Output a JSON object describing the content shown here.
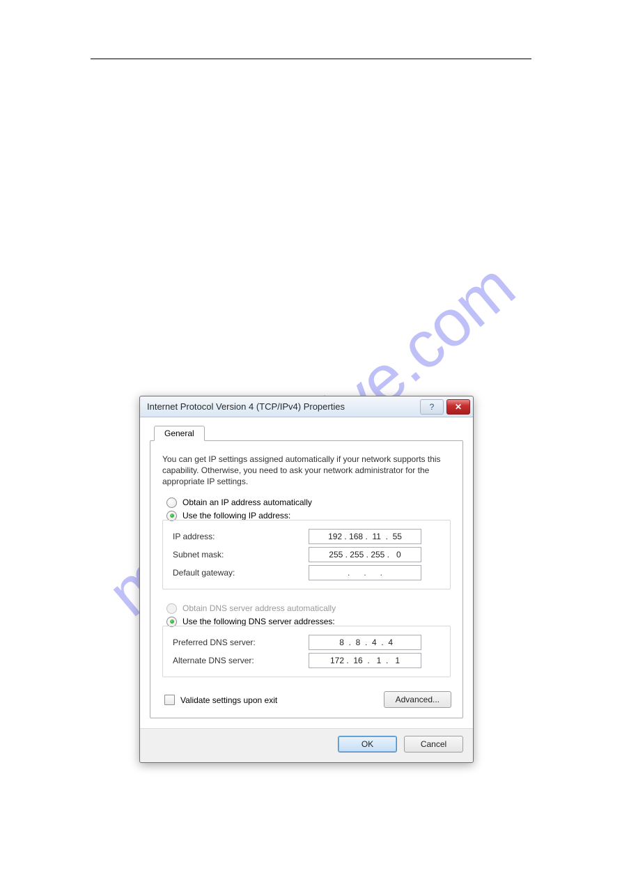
{
  "watermark": "manualshive.com",
  "dialog": {
    "title": "Internet Protocol Version 4 (TCP/IPv4) Properties",
    "tab": "General",
    "description": "You can get IP settings assigned automatically if your network supports this capability. Otherwise, you need to ask your network administrator for the appropriate IP settings.",
    "ip_group": {
      "obtain_label": "Obtain an IP address automatically",
      "use_label": "Use the following IP address:",
      "ip_address_label": "IP address:",
      "ip_address_value": "192 . 168 .  11  .  55",
      "subnet_label": "Subnet mask:",
      "subnet_value": "255 . 255 . 255 .   0",
      "gateway_label": "Default gateway:",
      "gateway_value": " .      .      . "
    },
    "dns_group": {
      "obtain_label": "Obtain DNS server address automatically",
      "use_label": "Use the following DNS server addresses:",
      "preferred_label": "Preferred DNS server:",
      "preferred_value": " 8  .  8  .  4  .  4",
      "alternate_label": "Alternate DNS server:",
      "alternate_value": "172 .  16  .   1  .   1"
    },
    "validate_label": "Validate settings upon exit",
    "advanced_label": "Advanced...",
    "ok_label": "OK",
    "cancel_label": "Cancel"
  }
}
